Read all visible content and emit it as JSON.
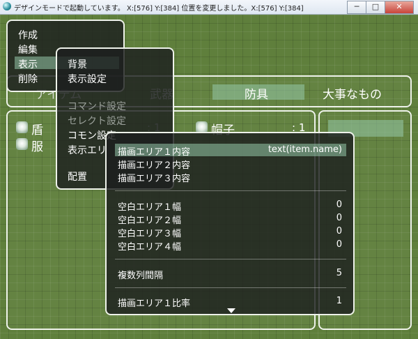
{
  "window": {
    "title": "デザインモードで起動しています。 X:[576] Y:[384] 位置を変更しました。X:[576] Y:[384]",
    "buttons": [
      "─",
      "□",
      "✕"
    ]
  },
  "main_menu": {
    "items": [
      "作成",
      "編集",
      "表示",
      "削除"
    ],
    "selected_index": 2
  },
  "category_tabs": {
    "items": [
      "アイテム",
      "武器",
      "防具",
      "大事なもの"
    ],
    "selected_index": 2
  },
  "item_list": [
    {
      "name": "盾",
      "count": ": 1"
    },
    {
      "name": "服",
      "count": ""
    },
    {
      "name": "帽子",
      "count": ": 1"
    }
  ],
  "display_menu": {
    "items": [
      "背景",
      "表示設定",
      "コマンド設定",
      "セレクト設定",
      "コモン設定",
      "表示エリ",
      "配置"
    ],
    "disabled": [
      2,
      3
    ]
  },
  "detail_menu": {
    "rows": [
      {
        "label": "描画エリア１内容",
        "value": "text(item.name)"
      },
      {
        "label": "描画エリア２内容",
        "value": ""
      },
      {
        "label": "描画エリア３内容",
        "value": ""
      },
      {
        "label": "空白エリア１幅",
        "value": "0"
      },
      {
        "label": "空白エリア２幅",
        "value": "0"
      },
      {
        "label": "空白エリア３幅",
        "value": "0"
      },
      {
        "label": "空白エリア４幅",
        "value": "0"
      },
      {
        "label": "複数列間隔",
        "value": "5"
      },
      {
        "label": "描画エリア１比率",
        "value": "1"
      }
    ],
    "selected_index": 0
  },
  "colors": {
    "highlight": "#96c8aa",
    "background": "#5f7f3c",
    "border": "#eef2ea"
  }
}
